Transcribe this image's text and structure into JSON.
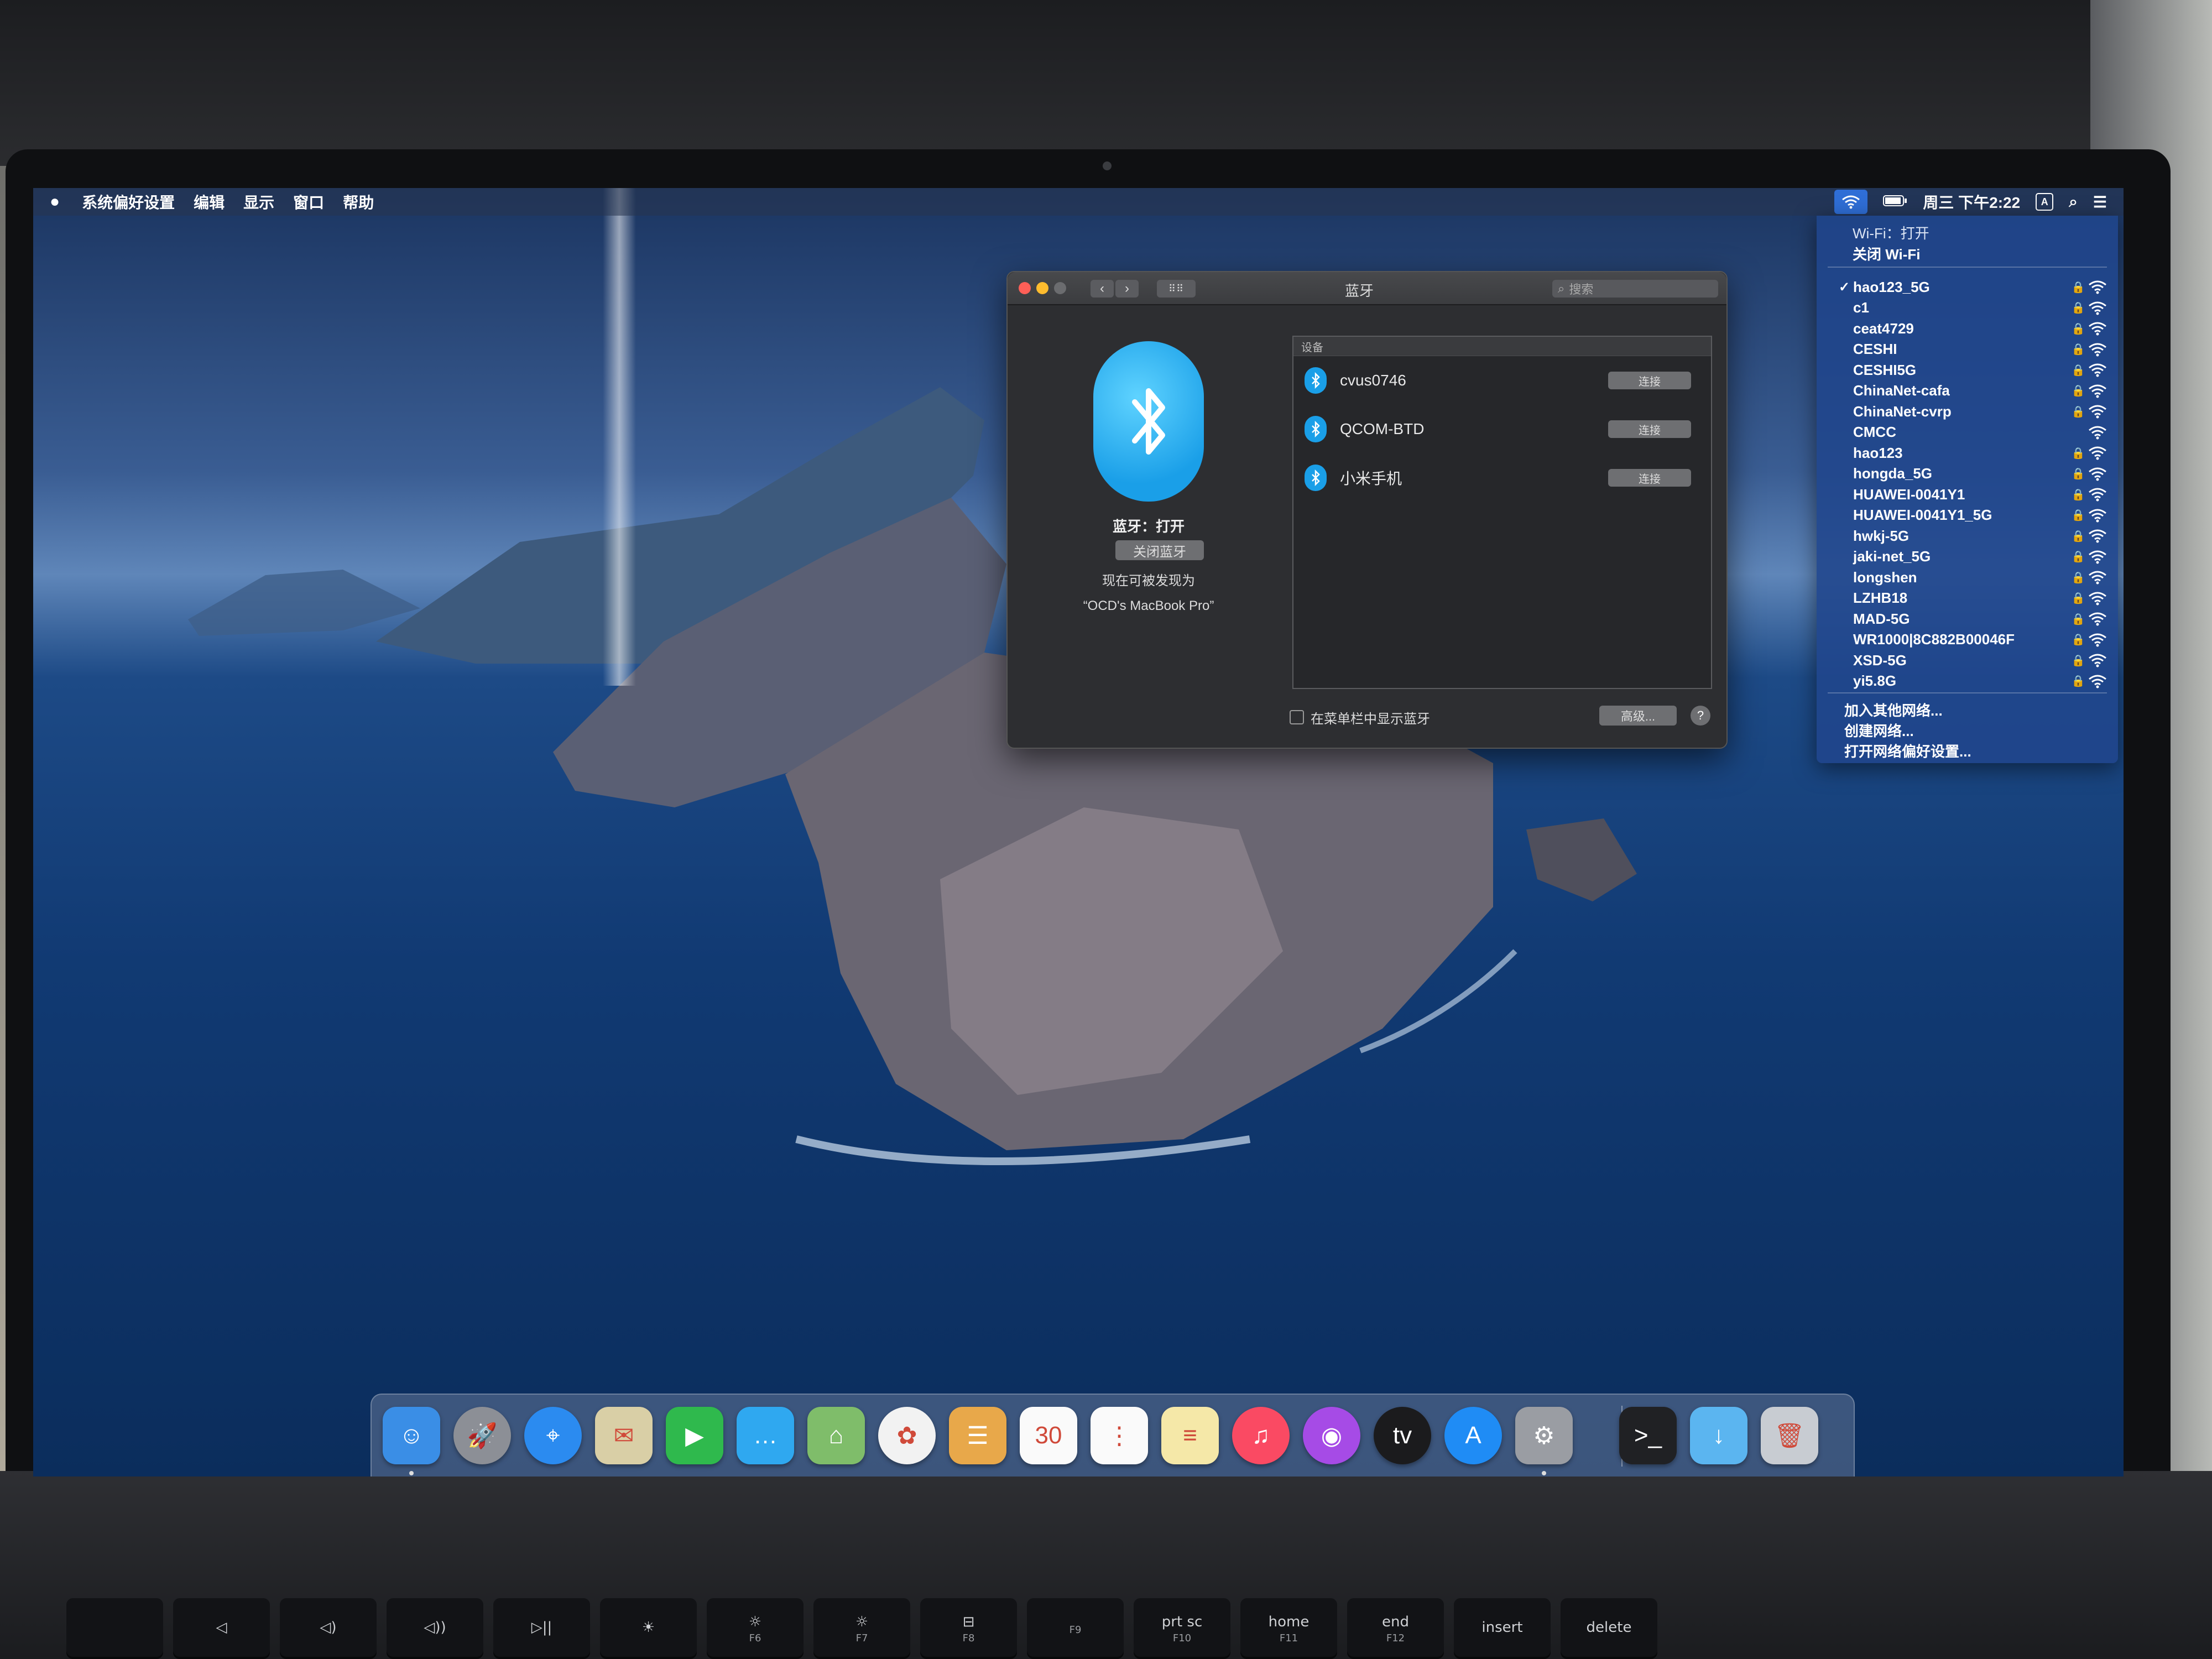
{
  "menubar": {
    "apple_icon": "apple-logo",
    "app_name": "系统偏好设置",
    "items": [
      "编辑",
      "显示",
      "窗口",
      "帮助"
    ],
    "clock": "周三 下午2:22",
    "input_method": "A",
    "status_icons": [
      "wifi-icon",
      "battery-icon",
      "search-icon",
      "list-icon"
    ]
  },
  "bluetooth_window": {
    "title": "蓝牙",
    "search_placeholder": "搜索",
    "status": "蓝牙：打开",
    "toggle_label": "关闭蓝牙",
    "discoverable_line1": "现在可被发现为",
    "discoverable_line2": "“OCD's MacBook Pro”",
    "devices_header": "设备",
    "devices": [
      {
        "name": "cvus0746",
        "action": "连接"
      },
      {
        "name": "QCOM-BTD",
        "action": "连接"
      },
      {
        "name": "小米手机",
        "action": "连接"
      }
    ],
    "show_in_menubar_label": "在菜单栏中显示蓝牙",
    "show_in_menubar_checked": false,
    "advanced_label": "高级...",
    "help_label": "?"
  },
  "wifi_menu": {
    "status": "Wi-Fi：打开",
    "toggle": "关闭 Wi-Fi",
    "networks": [
      {
        "ssid": "hao123_5G",
        "connected": true,
        "locked": true
      },
      {
        "ssid": "c1",
        "connected": false,
        "locked": true
      },
      {
        "ssid": "ceat4729",
        "connected": false,
        "locked": true
      },
      {
        "ssid": "CESHI",
        "connected": false,
        "locked": true
      },
      {
        "ssid": "CESHI5G",
        "connected": false,
        "locked": true
      },
      {
        "ssid": "ChinaNet-cafa",
        "connected": false,
        "locked": true
      },
      {
        "ssid": "ChinaNet-cvrp",
        "connected": false,
        "locked": true
      },
      {
        "ssid": "CMCC",
        "connected": false,
        "locked": false
      },
      {
        "ssid": "hao123",
        "connected": false,
        "locked": true
      },
      {
        "ssid": "hongda_5G",
        "connected": false,
        "locked": true
      },
      {
        "ssid": "HUAWEI-0041Y1",
        "connected": false,
        "locked": true
      },
      {
        "ssid": "HUAWEI-0041Y1_5G",
        "connected": false,
        "locked": true
      },
      {
        "ssid": "hwkj-5G",
        "connected": false,
        "locked": true
      },
      {
        "ssid": "jaki-net_5G",
        "connected": false,
        "locked": true
      },
      {
        "ssid": "longshen",
        "connected": false,
        "locked": true
      },
      {
        "ssid": "LZHB18",
        "connected": false,
        "locked": true
      },
      {
        "ssid": "MAD-5G",
        "connected": false,
        "locked": true
      },
      {
        "ssid": "WR1000|8C882B00046F",
        "connected": false,
        "locked": true
      },
      {
        "ssid": "XSD-5G",
        "connected": false,
        "locked": true
      },
      {
        "ssid": "yi5.8G",
        "connected": false,
        "locked": true
      }
    ],
    "join_other": "加入其他网络...",
    "create_network": "创建网络...",
    "open_prefs": "打开网络偏好设置..."
  },
  "dock": {
    "apps": [
      {
        "name": "finder-icon",
        "glyph": "☺",
        "color": "#3a8ee6"
      },
      {
        "name": "launchpad-icon",
        "glyph": "🚀",
        "color": "#8c8f96"
      },
      {
        "name": "safari-icon",
        "glyph": "⌖",
        "color": "#2b8bf0"
      },
      {
        "name": "mail-icon",
        "glyph": "✉",
        "color": "#d9cfa6"
      },
      {
        "name": "facetime-icon",
        "glyph": "▶",
        "color": "#2fb94d"
      },
      {
        "name": "messages-icon",
        "glyph": "…",
        "color": "#2fa8f0"
      },
      {
        "name": "maps-icon",
        "glyph": "⌂",
        "color": "#7fbd6a"
      },
      {
        "name": "photos-icon",
        "glyph": "✿",
        "color": "#f2f2f2"
      },
      {
        "name": "contacts-icon",
        "glyph": "☰",
        "color": "#e8a84a"
      },
      {
        "name": "calendar-icon",
        "glyph": "30",
        "color": "#fafafa"
      },
      {
        "name": "reminders-icon",
        "glyph": "⋮",
        "color": "#fafafa"
      },
      {
        "name": "notes-icon",
        "glyph": "≡",
        "color": "#f5e8a8"
      },
      {
        "name": "music-icon",
        "glyph": "♫",
        "color": "#fa4a63"
      },
      {
        "name": "podcasts-icon",
        "glyph": "◉",
        "color": "#a64be6"
      },
      {
        "name": "apple-tv-icon",
        "glyph": "tv",
        "color": "#1b1b1d"
      },
      {
        "name": "app-store-icon",
        "glyph": "A",
        "color": "#1f8cf5"
      },
      {
        "name": "system-preferences-icon",
        "glyph": "⚙",
        "color": "#9a9da3"
      },
      {
        "name": "terminal-icon",
        "glyph": ">_",
        "color": "#202124"
      },
      {
        "name": "downloads-folder-icon",
        "glyph": "↓",
        "color": "#5bb5f0"
      },
      {
        "name": "trash-icon",
        "glyph": "🗑",
        "color": "#c8ccd2"
      }
    ]
  },
  "keyboard": {
    "keys": [
      {
        "label": "",
        "sub": ""
      },
      {
        "label": "◁",
        "sub": ""
      },
      {
        "label": "◁)",
        "sub": ""
      },
      {
        "label": "◁))",
        "sub": ""
      },
      {
        "label": "▷||",
        "sub": ""
      },
      {
        "label": "☀",
        "sub": ""
      },
      {
        "label": "☼",
        "sub": "F6"
      },
      {
        "label": "☼",
        "sub": "F7"
      },
      {
        "label": "⊟",
        "sub": "F8"
      },
      {
        "label": "",
        "sub": "F9"
      },
      {
        "label": "prt sc",
        "sub": "F10"
      },
      {
        "label": "home",
        "sub": "F11"
      },
      {
        "label": "end",
        "sub": "F12"
      },
      {
        "label": "insert",
        "sub": ""
      },
      {
        "label": "delete",
        "sub": ""
      }
    ]
  }
}
